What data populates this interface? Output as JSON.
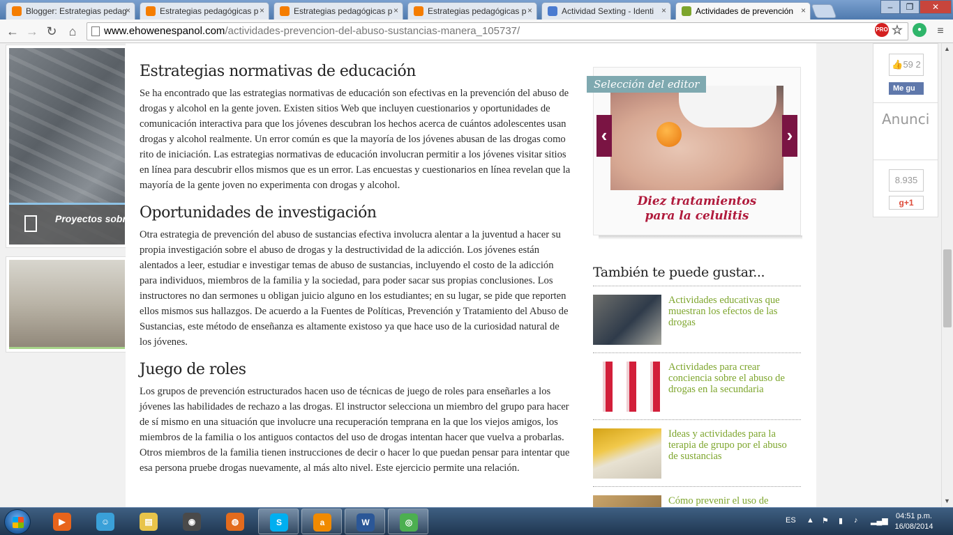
{
  "browser": {
    "tabs": [
      {
        "label": "Blogger: Estrategias pedag",
        "favicon_color": "#f57d00"
      },
      {
        "label": "Estrategias pedagógicas p",
        "favicon_color": "#f57d00"
      },
      {
        "label": "Estrategias pedagógicas p",
        "favicon_color": "#f57d00"
      },
      {
        "label": "Estrategias pedagógicas p",
        "favicon_color": "#f57d00"
      },
      {
        "label": "Actividad Sexting - Identi",
        "favicon_color": "#4a7bd0"
      },
      {
        "label": "Actividades de prevención",
        "favicon_color": "#7da52c"
      }
    ],
    "close_glyph": "×",
    "window_buttons": {
      "minimize": "‒",
      "maximize": "❐",
      "close": "✕"
    },
    "nav": {
      "back": "←",
      "forward": "→",
      "reload": "↻",
      "home": "⌂"
    },
    "url": {
      "domain": "www.ehowenespanol.com",
      "path": "/actividades-prevencion-del-abuso-sustancias-manera_105737/"
    },
    "omnibox_icons": {
      "pro_badge": "PRO",
      "star": "☆",
      "extension": "●"
    }
  },
  "sidebar_left": {
    "card1_caption": "Proyectos sobre drogas para adolescentes"
  },
  "article": {
    "sections": [
      {
        "heading": "Estrategias normativas de educación",
        "body": "Se ha encontrado que las estrategias normativas de educación son efectivas en la prevención del abuso de drogas y alcohol en la gente joven. Existen sitios Web que incluyen cuestionarios y oportunidades de comunicación interactiva para que los jóvenes descubran los hechos acerca de cuántos adolescentes usan drogas y alcohol realmente. Un error común es que la mayoría de los jóvenes abusan de las drogas como rito de iniciación. Las estrategias normativas de educación involucran permitir a los jóvenes visitar sitios en línea para descubrir ellos mismos que es un error. Las encuestas y cuestionarios en línea revelan que la mayoría de la gente joven no experimenta con drogas y alcohol."
      },
      {
        "heading": "Oportunidades de investigación",
        "body": "Otra estrategia de prevención del abuso de sustancias efectiva involucra alentar a la juventud a hacer su propia investigación sobre el abuso de drogas y la destructividad de la adicción. Los jóvenes están alentados a leer, estudiar e investigar temas de abuso de sustancias, incluyendo el costo de la adicción para individuos, miembros de la familia y la sociedad, para poder sacar sus propias conclusiones. Los instructores no dan sermones u obligan juicio alguno en los estudiantes; en su lugar, se pide que reporten ellos mismos sus hallazgos. De acuerdo a la Fuentes de Políticas, Prevención y Tratamiento del Abuso de Sustancias, este método de enseñanza es altamente existoso ya que hace uso de la curiosidad natural de los jóvenes."
      },
      {
        "heading": "Juego de roles",
        "body": "Los grupos de prevención estructurados hacen uso de técnicas de juego de roles para enseñarles a los jóvenes las habilidades de rechazo a las drogas. El instructor selecciona un miembro del grupo para hacer de sí mismo en una situación que involucre una recuperación temprana en la que los viejos amigos, los miembros de la familia o los antiguos contactos del uso de drogas intentan hacer que vuelva a probarlas. Otros miembros de la familia tienen instrucciones de decir o hacer lo que puedan pensar para intentar que esa persona pruebe drogas nuevamente, al más alto nivel. Este ejercicio permite una relación."
      }
    ]
  },
  "editor_pick": {
    "tag": "Selección del editor",
    "caption_line1": "Diez tratamientos",
    "caption_line2": "para la celulitis",
    "prev_glyph": "‹",
    "next_glyph": "›",
    "accent_color": "#7a1443"
  },
  "related": {
    "title": "También te puede gustar...",
    "items": [
      {
        "label": "Actividades educativas que muestran los efectos de las drogas"
      },
      {
        "label": "Actividades para crear conciencia sobre el abuso de drogas en la secundaria"
      },
      {
        "label": "Ideas y actividades para la terapia de grupo por el abuso de sustancias"
      },
      {
        "label": "Cómo prevenir el uso de"
      }
    ],
    "link_color": "#7da52c"
  },
  "social": {
    "fb_count": "59 2",
    "fb_label": "Me gu",
    "ad_label": "Anunci",
    "gplus_count": "8.935",
    "gplus_label": "g+1"
  },
  "taskbar": {
    "language": "ES",
    "time": "04:51 p.m.",
    "date": "16/08/2014",
    "apps": [
      {
        "name": "media-player",
        "color": "#e8641b",
        "glyph": "▶",
        "open": false
      },
      {
        "name": "network-people",
        "color": "#3aa0d8",
        "glyph": "☺",
        "open": false
      },
      {
        "name": "file-explorer",
        "color": "#e8c44a",
        "glyph": "▤",
        "open": false
      },
      {
        "name": "webcam",
        "color": "#4a4a4a",
        "glyph": "◉",
        "open": false
      },
      {
        "name": "firefox",
        "color": "#e36b1d",
        "glyph": "◍",
        "open": false
      },
      {
        "name": "skype",
        "color": "#00aff0",
        "glyph": "S",
        "open": true
      },
      {
        "name": "avast",
        "color": "#f08a00",
        "glyph": "a",
        "open": true
      },
      {
        "name": "word",
        "color": "#2b5797",
        "glyph": "W",
        "open": true
      },
      {
        "name": "chrome",
        "color": "#4caf50",
        "glyph": "◎",
        "open": true
      }
    ]
  }
}
